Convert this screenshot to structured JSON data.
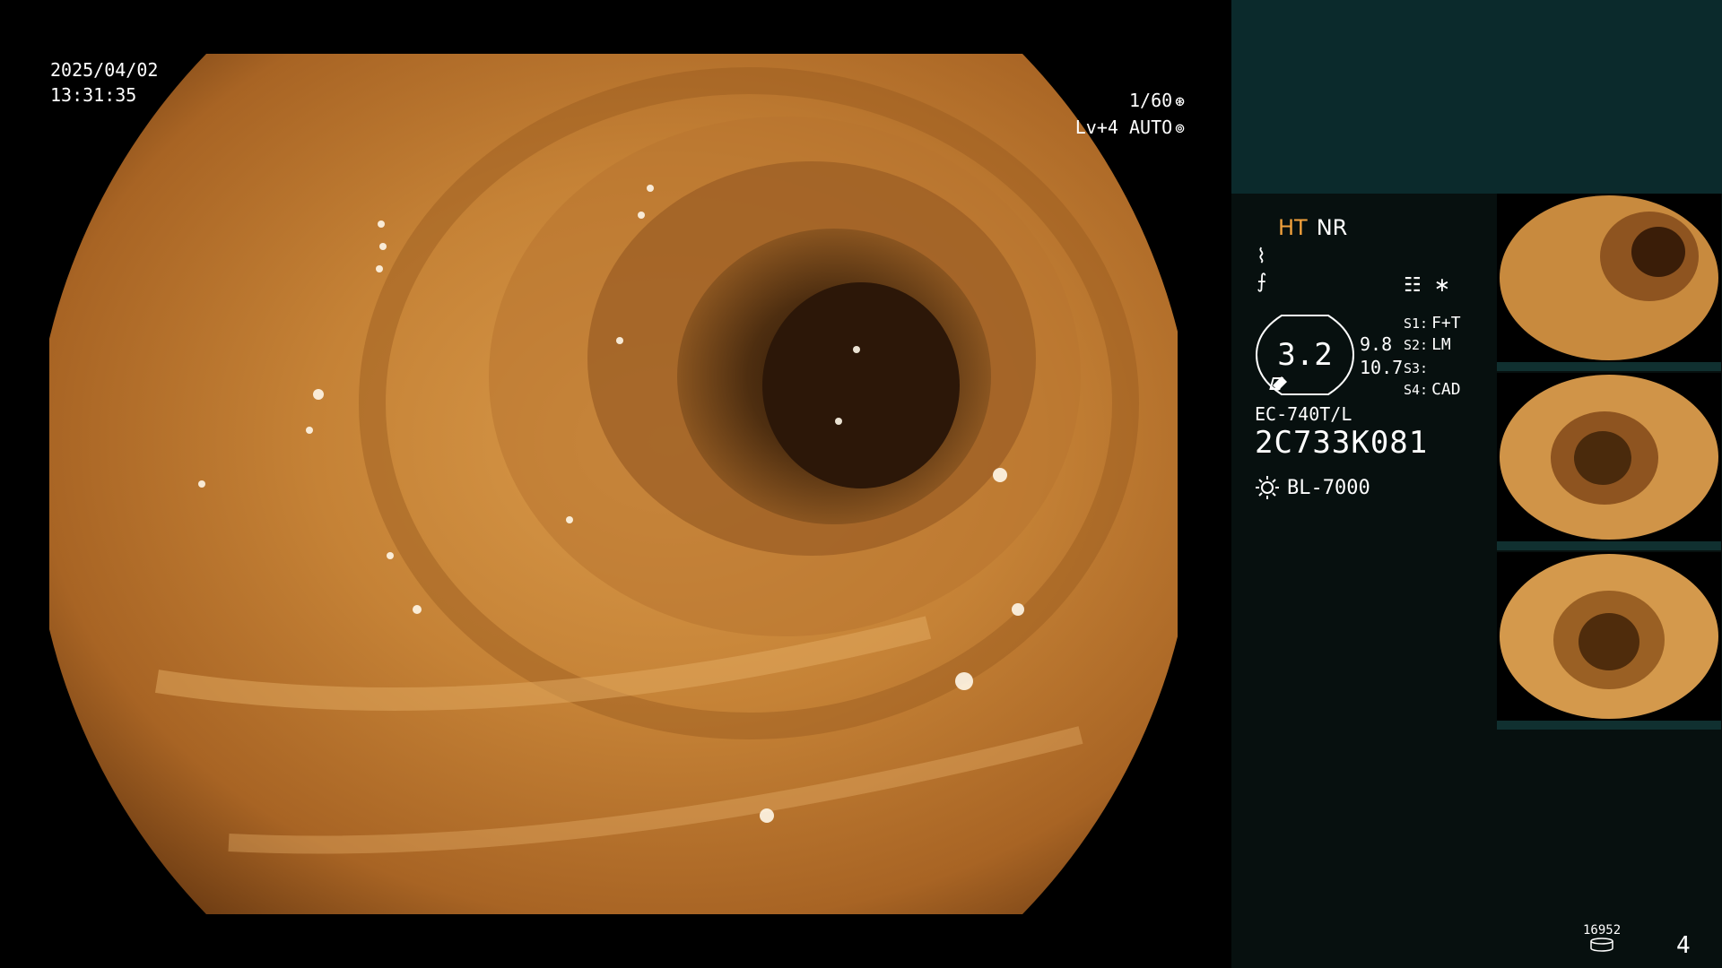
{
  "overlay": {
    "date": "2025/04/02",
    "time": "13:31:35",
    "shutter": "1/60",
    "level": "Lv+4",
    "mode": "AUTO",
    "shutter_icon": "aperture-icon",
    "mode_icon": "iris-icon"
  },
  "panel": {
    "ht_label": "HT",
    "nr_label": "NR",
    "sym1": "⌇",
    "sym2": "⨍",
    "icons": [
      "menu-icon",
      "asterisk-icon"
    ],
    "zoom": "3.2",
    "meas_1": "9.8",
    "meas_2": "10.7",
    "slots": [
      {
        "label": "S1:",
        "value": "F+T"
      },
      {
        "label": "S2:",
        "value": "LM"
      },
      {
        "label": "S3:",
        "value": ""
      },
      {
        "label": "S4:",
        "value": "CAD"
      }
    ],
    "scope_model": "EC-740T/L",
    "scope_serial": "2C733K081",
    "light_source": "BL-7000",
    "counter": "16952",
    "page": "4"
  },
  "colors": {
    "panel_bg": "#07100f",
    "panel_top_bg": "#0b2a2c",
    "ht_accent": "#f2a13c",
    "tissue": "#c07a2e"
  }
}
